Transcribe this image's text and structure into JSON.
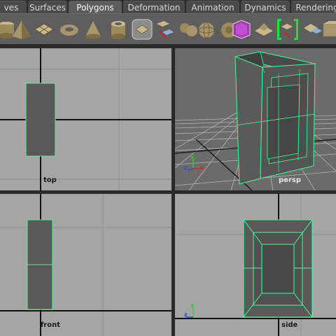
{
  "tabs": [
    {
      "label": "ves",
      "active": false
    },
    {
      "label": "Surfaces",
      "active": false
    },
    {
      "label": "Polygons",
      "active": true
    },
    {
      "label": "Deformation",
      "active": false
    },
    {
      "label": "Animation",
      "active": false
    },
    {
      "label": "Dynamics",
      "active": false
    },
    {
      "label": "Rendering",
      "active": false
    }
  ],
  "shelf_tools": [
    "poly-cylinder-icon",
    "poly-pyramid-icon",
    "poly-plane-icon",
    "poly-torus-icon",
    "poly-cone-icon",
    "poly-pipe-icon",
    "poly-helix-icon",
    "poly-transfer-icon",
    "combine-icon",
    "poly-sphere-icon",
    "smooth-icon",
    "bevel-icon",
    "extrude-icon",
    "mirror-icon",
    "split-icon",
    "wedge-icon"
  ],
  "viewports": {
    "top": {
      "label": "top"
    },
    "persp": {
      "label": "persp"
    },
    "front": {
      "label": "front"
    },
    "side": {
      "label": "side"
    }
  },
  "axis": {
    "z_label": "z",
    "x_label": "x",
    "y_label": "y"
  },
  "colors": {
    "selection_wire": "#3dff9a",
    "viewport_bg": "#a5a5a5",
    "persp_bg": "#6b6b6b",
    "mesh_fill": "#5a5a5a",
    "shelf_bg": "#5e5e5e",
    "tab_active": "#5d5d5d"
  }
}
